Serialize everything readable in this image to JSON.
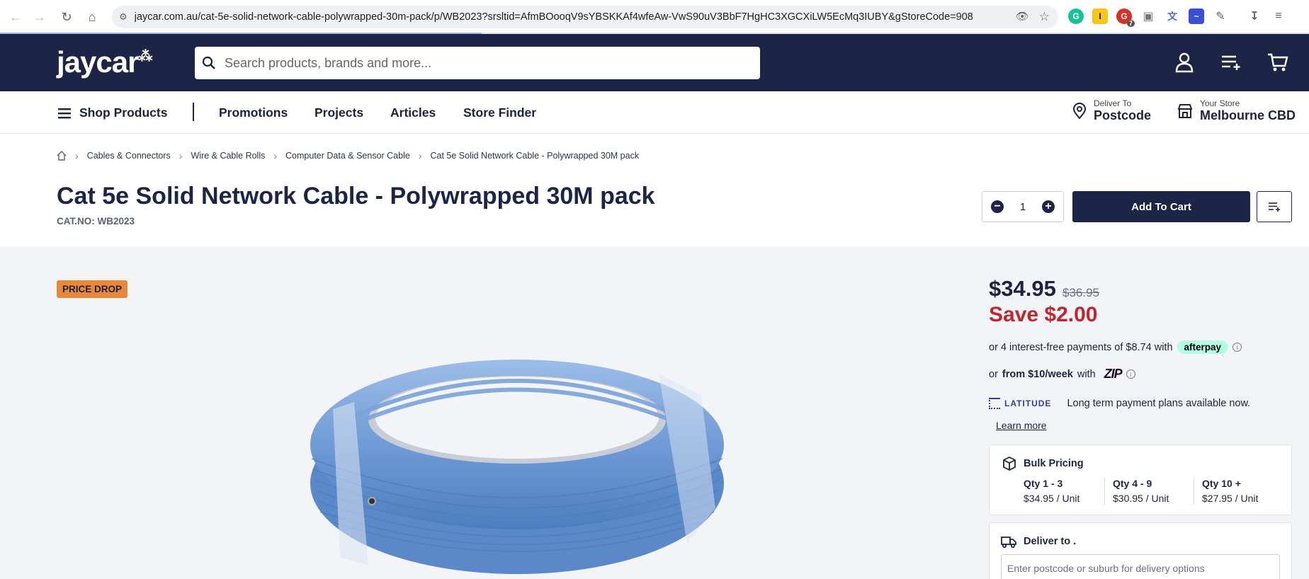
{
  "browser": {
    "url": "jaycar.com.au/cat-5e-solid-network-cable-polywrapped-30m-pack/p/WB2023?srsltid=AfmBOooqV9sYBSKKAf4wfeAw-VwS90uV3BbF7HgHC3XGCXiLW5EcMq3IUBY&gStoreCode=908",
    "ext_badge_count": "7"
  },
  "header": {
    "logo_text": "jaycar",
    "logo_spark": "⁂",
    "search_placeholder": "Search products, brands and more..."
  },
  "nav": {
    "shop_products": "Shop Products",
    "items": [
      "Promotions",
      "Projects",
      "Articles",
      "Store Finder"
    ],
    "deliver_small": "Deliver To",
    "deliver_big": "Postcode",
    "store_small": "Your Store",
    "store_big": "Melbourne CBD"
  },
  "breadcrumb": [
    "Cables & Connectors",
    "Wire & Cable Rolls",
    "Computer Data & Sensor Cable",
    "Cat 5e Solid Network Cable - Polywrapped 30M pack"
  ],
  "product": {
    "title": "Cat 5e Solid Network Cable - Polywrapped 30M pack",
    "cat_no": "CAT.NO: WB2023",
    "quantity": "1",
    "add_to_cart": "Add To Cart",
    "badge": "PRICE DROP"
  },
  "pricing": {
    "price": "$34.95",
    "old_price": "$36.95",
    "save": "Save $2.00",
    "afterpay_text": "or 4 interest-free payments of $8.74 with",
    "afterpay_logo": "afterpay",
    "zip_prefix": "or",
    "zip_bold": "from $10/week",
    "zip_suffix": "with",
    "zip_logo": "ZIP",
    "latitude_logo": "LATITUDE",
    "latitude_text": "Long term payment plans available now.",
    "learn_more": "Learn more"
  },
  "bulk": {
    "title": "Bulk Pricing",
    "tiers": [
      {
        "qty": "Qty 1 - 3",
        "price": "$34.95 / Unit"
      },
      {
        "qty": "Qty 4 - 9",
        "price": "$30.95 / Unit"
      },
      {
        "qty": "Qty 10 +",
        "price": "$27.95 / Unit"
      }
    ]
  },
  "delivery": {
    "title": "Deliver to",
    "title_suffix": ".",
    "placeholder": "Enter postcode or suburb for delivery options"
  },
  "colors": {
    "navy": "#1d2547",
    "sale_red": "#c0272d",
    "badge_orange": "#e8893a",
    "cable_blue": "#7ea6dc"
  }
}
